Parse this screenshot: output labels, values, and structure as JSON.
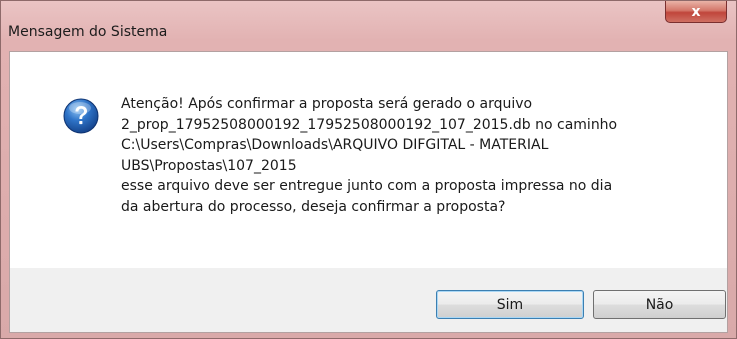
{
  "window": {
    "title": "Mensagem do Sistema",
    "close_label": "x"
  },
  "dialog": {
    "icon": "question-icon",
    "message_lines": [
      "Atenção! Após confirmar a proposta será gerado o arquivo",
      "2_prop_17952508000192_17952508000192_107_2015.db no caminho",
      "C:\\Users\\Compras\\Downloads\\ARQUIVO DIFGITAL - MATERIAL",
      "UBS\\Propostas\\107_2015",
      "esse arquivo deve ser entregue junto com a proposta impressa no dia",
      "da abertura do processo, deseja confirmar a proposta?"
    ]
  },
  "buttons": {
    "yes_label": "Sim",
    "no_label": "Não"
  }
}
